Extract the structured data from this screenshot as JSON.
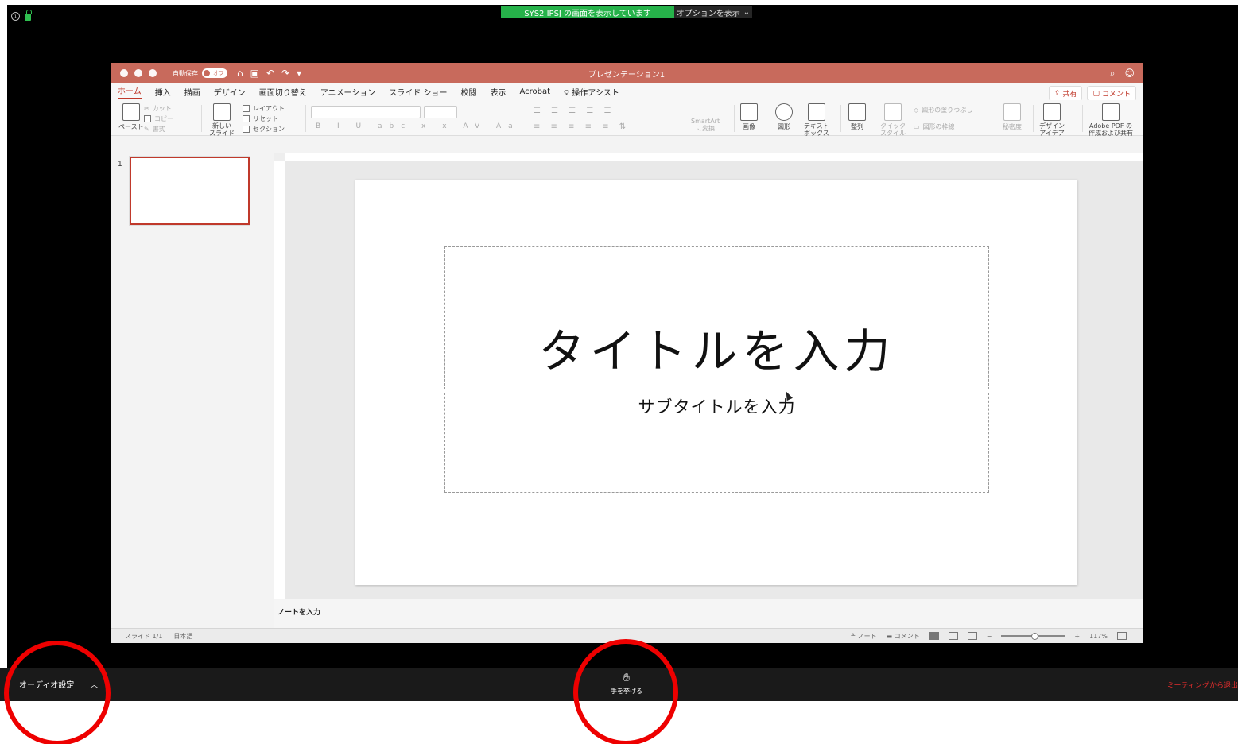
{
  "zoom": {
    "share_banner": "SYS2 IPSJ の画面を表示しています",
    "options_label": "オプションを表示",
    "audio_label": "オーディオ設定",
    "raise_hand_label": "手を挙げる",
    "leave_label": "ミーティングから退出",
    "accent_green": "#26b24a",
    "leave_color": "#e02d2d"
  },
  "ppt": {
    "doc_title": "プレゼンテーション1",
    "autosave_label": "自動保存",
    "autosave_state": "オフ",
    "tabs": [
      "ホーム",
      "挿入",
      "描画",
      "デザイン",
      "画面切り替え",
      "アニメーション",
      "スライド ショー",
      "校閲",
      "表示",
      "Acrobat",
      "操作アシスト"
    ],
    "share_label": "共有",
    "comment_label": "コメント",
    "ribbon": {
      "paste": "ペースト",
      "cut": "カット",
      "copy": "コピー",
      "format": "書式",
      "new_slide": "新しい\nスライド",
      "layout": "レイアウト",
      "reset": "リセット",
      "section": "セクション",
      "smartart": "SmartArt\nに変換",
      "picture": "画像",
      "shapes": "図形",
      "textbox": "テキスト\nボックス",
      "arrange": "整列",
      "quick_styles": "クイック\nスタイル",
      "shape_fill": "図形の塗りつぶし",
      "shape_outline": "図形の枠線",
      "dictate": "秘密度",
      "design_ideas": "デザイン\nアイデア",
      "adobe_pdf": "Adobe PDF の\n作成および共有"
    },
    "slide_number": "1",
    "slide_title_placeholder": "タイトルを入力",
    "slide_subtitle_placeholder": "サブタイトルを入力",
    "notes_placeholder": "ノートを入力",
    "status": {
      "slide": "スライド 1/1",
      "language": "日本語",
      "notes": "ノート",
      "comments": "コメント",
      "zoom": "117%"
    },
    "titlebar_color": "#c86a5c",
    "accent_red": "#c0392b"
  }
}
